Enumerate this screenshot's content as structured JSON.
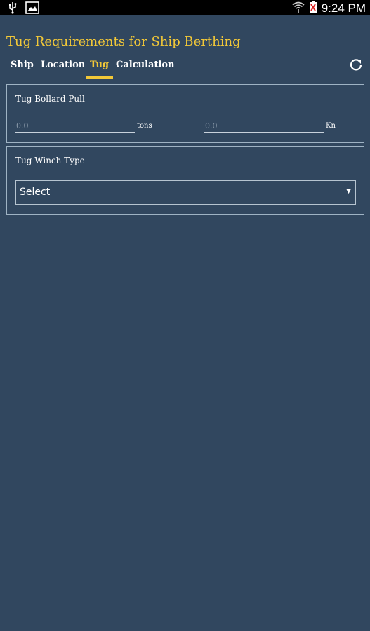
{
  "status_bar": {
    "time": "9:24 PM",
    "icons": [
      "usb-icon",
      "gallery-icon",
      "wifi-icon",
      "battery-icon"
    ]
  },
  "app": {
    "title": "Tug Requirements for Ship Berthing"
  },
  "tabs": [
    {
      "label": "Ship",
      "active": false
    },
    {
      "label": "Location",
      "active": false
    },
    {
      "label": "Tug",
      "active": true
    },
    {
      "label": "Calculation",
      "active": false
    }
  ],
  "toolbar": {
    "refresh_icon": "refresh-icon"
  },
  "bollard_pull": {
    "label": "Tug Bollard Pull",
    "tons_placeholder": "0.0",
    "tons_unit": "tons",
    "kn_placeholder": "0.0",
    "kn_unit": "Kn"
  },
  "winch_type": {
    "label": "Tug Winch Type",
    "selected": "Select"
  },
  "colors": {
    "background": "#31475f",
    "accent": "#f2c838",
    "text": "#ffffff",
    "border": "#9fb3c4"
  }
}
